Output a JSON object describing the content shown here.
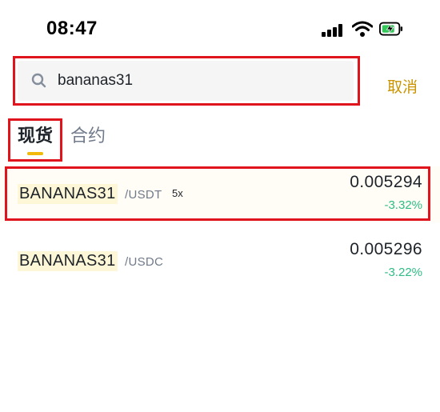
{
  "status_bar": {
    "time": "08:47",
    "icons": [
      "signal-icon",
      "wifi-icon",
      "battery-charging-icon"
    ]
  },
  "search": {
    "value": "bananas31",
    "icon": "search-icon",
    "cancel_label": "取消"
  },
  "tabs": [
    {
      "label": "现货",
      "active": true
    },
    {
      "label": "合约",
      "active": false
    }
  ],
  "results": [
    {
      "base": "BANANAS31",
      "quote": "/USDT",
      "leverage": "5x",
      "price": "0.005294",
      "change": "-3.32%"
    },
    {
      "base": "BANANAS31",
      "quote": "/USDC",
      "leverage": "",
      "price": "0.005296",
      "change": "-3.22%"
    }
  ],
  "colors": {
    "accent": "#f0b90b",
    "cancel_text": "#c99400",
    "change_green": "#2ebd85",
    "highlight_red": "#e0141c"
  }
}
